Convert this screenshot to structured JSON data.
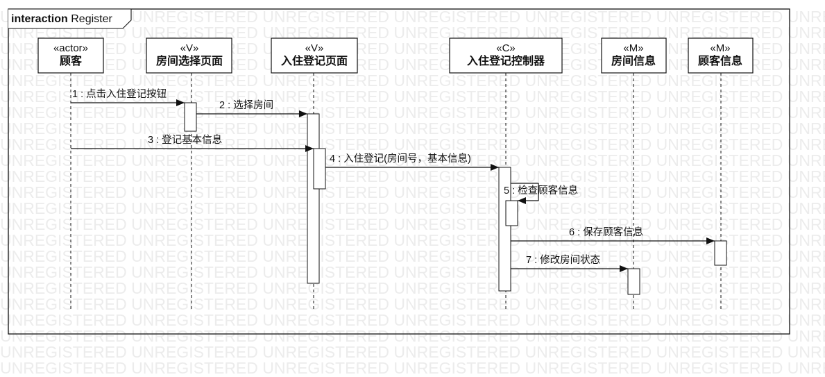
{
  "watermark": {
    "text": "UNREGISTERED"
  },
  "frame": {
    "keyword": "interaction",
    "name": "Register"
  },
  "lifelines": [
    {
      "id": "customer",
      "stereotype": "«actor»",
      "name": "顾客"
    },
    {
      "id": "room-select-page",
      "stereotype": "«V»",
      "name": "房间选择页面"
    },
    {
      "id": "checkin-page",
      "stereotype": "«V»",
      "name": "入住登记页面"
    },
    {
      "id": "checkin-controller",
      "stereotype": "«C»",
      "name": "入住登记控制器"
    },
    {
      "id": "room-info",
      "stereotype": "«M»",
      "name": "房间信息"
    },
    {
      "id": "customer-info",
      "stereotype": "«M»",
      "name": "顾客信息"
    }
  ],
  "messages": [
    {
      "seq": "1",
      "label": "1 : 点击入住登记按钮",
      "from": "customer",
      "to": "room-select-page"
    },
    {
      "seq": "2",
      "label": "2 : 选择房间",
      "from": "room-select-page",
      "to": "checkin-page"
    },
    {
      "seq": "3",
      "label": "3 : 登记基本信息",
      "from": "customer",
      "to": "checkin-page"
    },
    {
      "seq": "4",
      "label": "4 : 入住登记(房间号，基本信息)",
      "from": "checkin-page",
      "to": "checkin-controller"
    },
    {
      "seq": "5",
      "label": "5 : 检查顾客信息",
      "from": "checkin-controller",
      "to": "checkin-controller"
    },
    {
      "seq": "6",
      "label": "6 : 保存顾客信息",
      "from": "checkin-controller",
      "to": "customer-info"
    },
    {
      "seq": "7",
      "label": "7 : 修改房间状态",
      "from": "checkin-controller",
      "to": "room-info"
    }
  ],
  "colors": {
    "line": "#111111",
    "watermark": "#ececec",
    "background": "#ffffff"
  }
}
